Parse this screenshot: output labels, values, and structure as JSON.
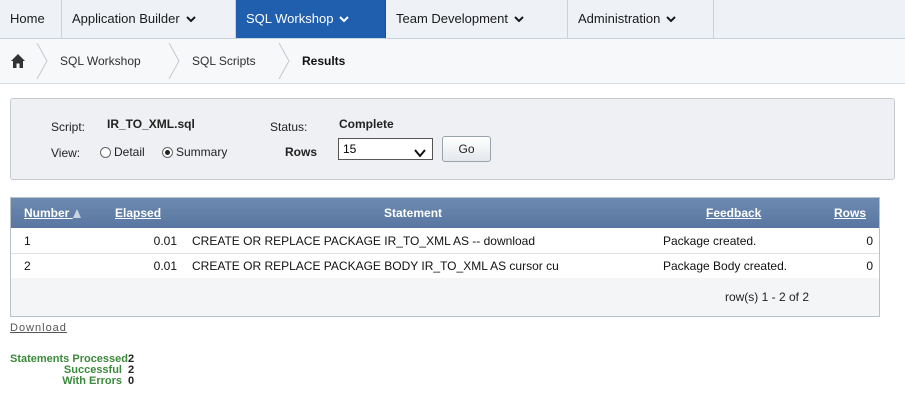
{
  "tabs": [
    {
      "label": "Home",
      "dropdown": false,
      "active": false
    },
    {
      "label": "Application Builder",
      "dropdown": true,
      "active": false
    },
    {
      "label": "SQL Workshop",
      "dropdown": true,
      "active": true
    },
    {
      "label": "Team Development",
      "dropdown": true,
      "active": false
    },
    {
      "label": "Administration",
      "dropdown": true,
      "active": false
    }
  ],
  "breadcrumb": [
    "SQL Workshop",
    "SQL Scripts",
    "Results"
  ],
  "form": {
    "script_label": "Script:",
    "script_value": "IR_TO_XML.sql",
    "status_label": "Status:",
    "status_value": "Complete",
    "view_label": "View:",
    "view_options": [
      "Detail",
      "Summary"
    ],
    "view_selected": "Summary",
    "rows_label": "Rows",
    "rows_value": "15",
    "go_label": "Go"
  },
  "table": {
    "columns": [
      "Number",
      "Elapsed",
      "Statement",
      "Feedback",
      "Rows"
    ],
    "rows": [
      {
        "number": "1",
        "elapsed": "0.01",
        "statement": "CREATE OR REPLACE PACKAGE IR_TO_XML AS -- download",
        "feedback": "Package created.",
        "rows": "0"
      },
      {
        "number": "2",
        "elapsed": "0.01",
        "statement": "CREATE OR REPLACE PACKAGE BODY IR_TO_XML AS cursor cu",
        "feedback": "Package Body created.",
        "rows": "0"
      }
    ],
    "pagination": "row(s) 1 - 2 of 2"
  },
  "download_label": "Download",
  "stats": [
    {
      "label": "Statements Processed",
      "value": "2"
    },
    {
      "label": "Successful",
      "value": "2"
    },
    {
      "label": "With Errors",
      "value": "0"
    }
  ],
  "colors": {
    "active_tab": "#1f5fae",
    "table_header": "#5f7ea8",
    "stat_label": "#3b8a3b"
  }
}
